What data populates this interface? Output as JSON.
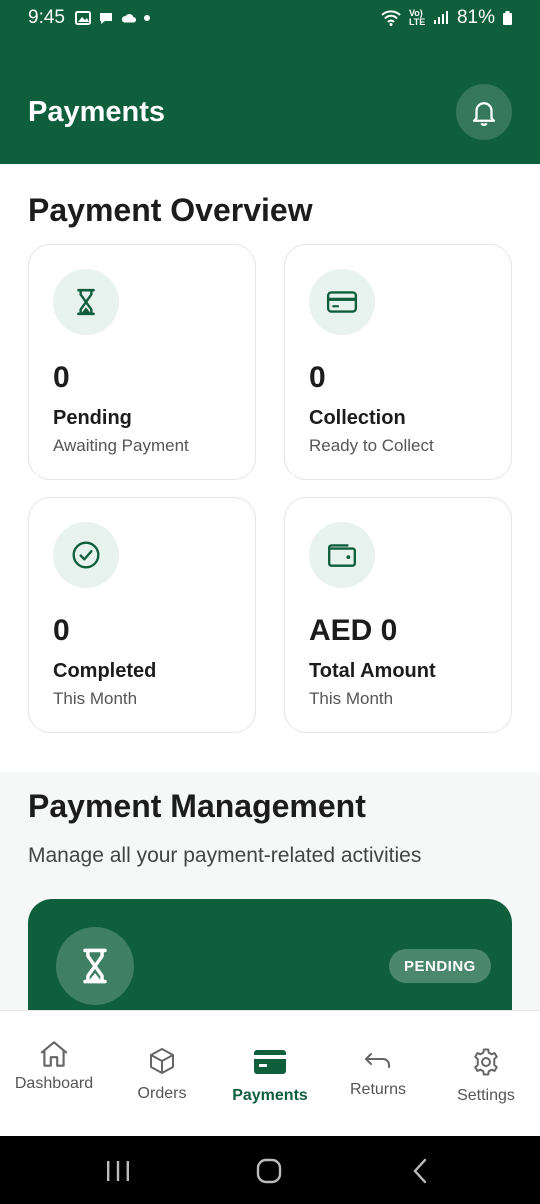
{
  "status_bar": {
    "time": "9:45",
    "battery": "81%",
    "network": "Vo) LTE"
  },
  "header": {
    "title": "Payments",
    "bell_icon": "bell-icon"
  },
  "overview": {
    "title": "Payment Overview",
    "cards": [
      {
        "icon": "hourglass-icon",
        "value": "0",
        "label": "Pending",
        "sub": "Awaiting Payment"
      },
      {
        "icon": "credit-card-icon",
        "value": "0",
        "label": "Collection",
        "sub": "Ready to Collect"
      },
      {
        "icon": "check-circle-icon",
        "value": "0",
        "label": "Completed",
        "sub": "This Month"
      },
      {
        "icon": "wallet-icon",
        "value": "AED 0",
        "label": "Total Amount",
        "sub": "This Month"
      }
    ]
  },
  "management": {
    "title": "Payment Management",
    "description": "Manage all your payment-related activities",
    "card": {
      "icon": "hourglass-icon",
      "badge": "PENDING"
    }
  },
  "bottom_nav": {
    "active": "Payments",
    "items": [
      {
        "label": "Dashboard",
        "icon": "home-icon"
      },
      {
        "label": "Orders",
        "icon": "box-icon"
      },
      {
        "label": "Payments",
        "icon": "payment-card-icon"
      },
      {
        "label": "Returns",
        "icon": "return-arrow-icon"
      },
      {
        "label": "Settings",
        "icon": "gear-icon"
      }
    ]
  },
  "colors": {
    "primary": "#0f5f3d",
    "icon_bg": "#e8f2ee"
  }
}
